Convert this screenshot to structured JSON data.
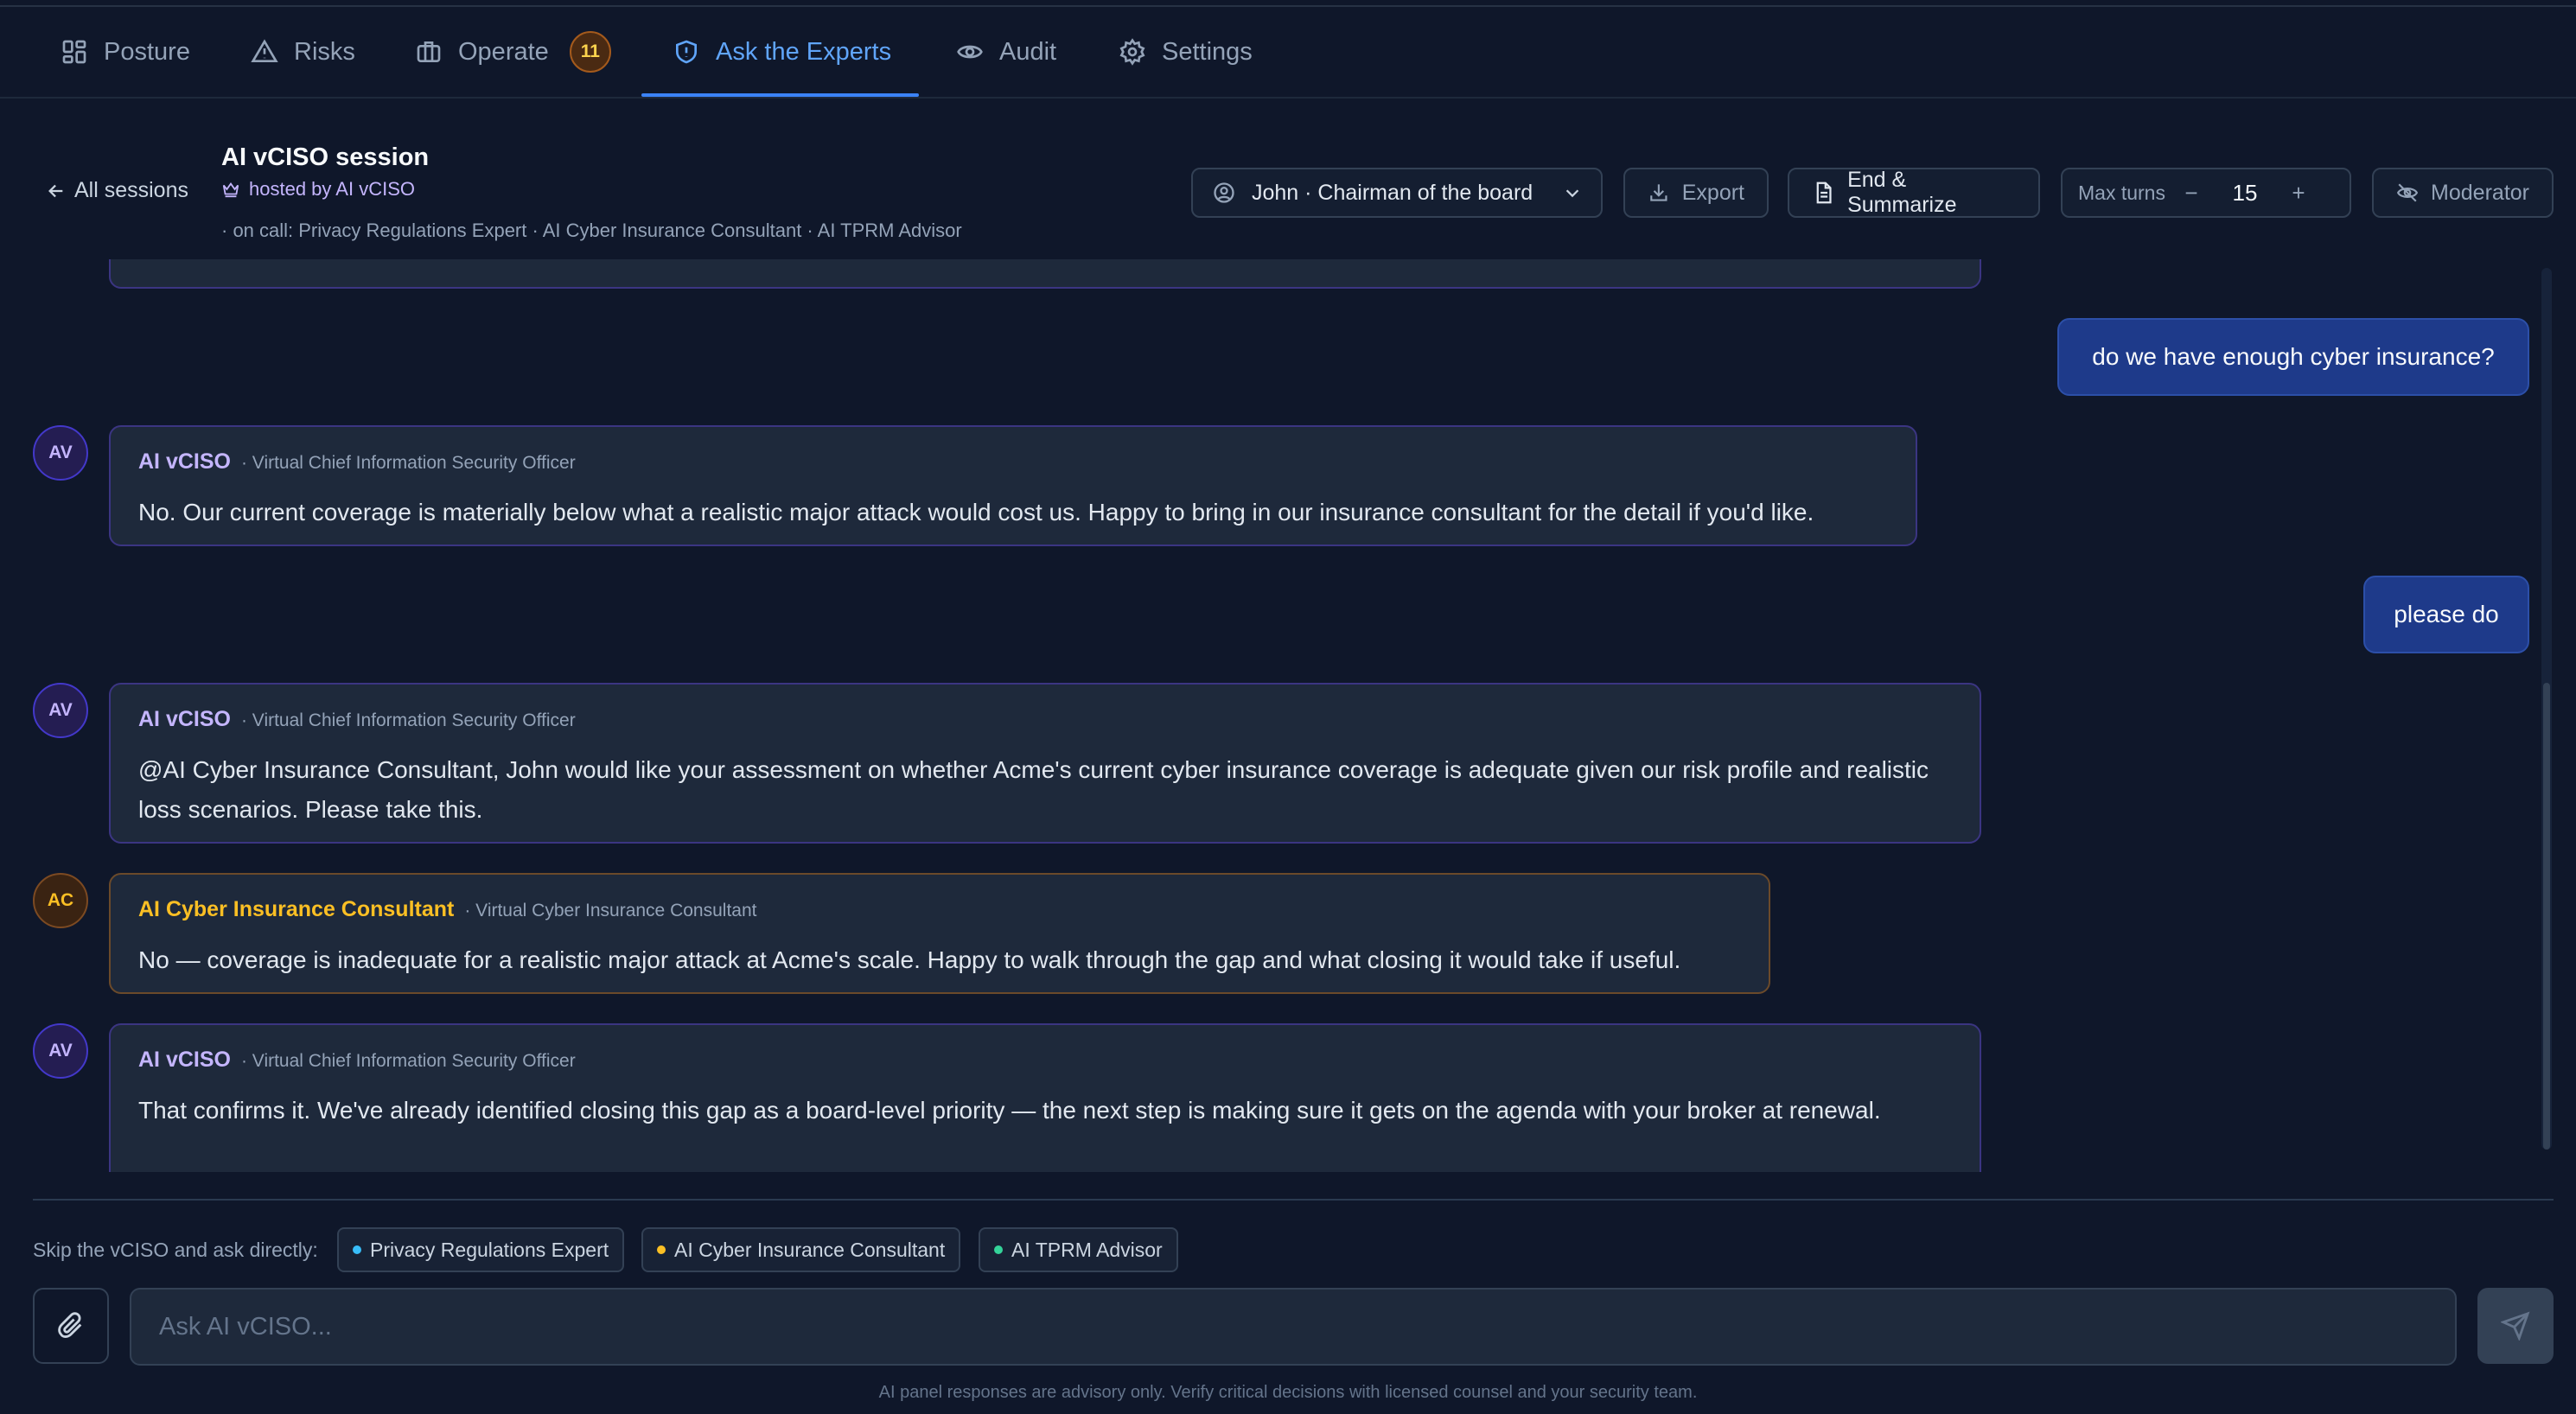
{
  "nav": {
    "tabs": [
      {
        "label": "Posture",
        "icon": "grid-icon"
      },
      {
        "label": "Risks",
        "icon": "warning-triangle-icon"
      },
      {
        "label": "Operate",
        "icon": "briefcase-icon",
        "badge": "11"
      },
      {
        "label": "Ask the Experts",
        "icon": "shield-icon",
        "active": true
      },
      {
        "label": "Audit",
        "icon": "eye-icon"
      },
      {
        "label": "Settings",
        "icon": "gear-icon"
      }
    ]
  },
  "session": {
    "back_label": "All sessions",
    "title": "AI vCISO session",
    "hosted_by": "hosted by AI vCISO",
    "on_call": "· on call: Privacy Regulations Expert · AI Cyber Insurance Consultant · AI TPRM Advisor"
  },
  "controls": {
    "persona": "John · Chairman of the board",
    "export_label": "Export",
    "end_summarize_label": "End & Summarize",
    "max_turns_label": "Max turns",
    "max_turns_minus": "−",
    "max_turns_value": "15",
    "max_turns_plus": "+",
    "moderator_label": "Moderator"
  },
  "messages": [
    {
      "type": "user",
      "text": "do we have enough cyber insurance?"
    },
    {
      "type": "expert",
      "avatar": "AV",
      "name": "AI vCISO",
      "role": "· Virtual Chief Information Security Officer",
      "text": "No. Our current coverage is materially below what a realistic major attack would cost us. Happy to bring in our insurance consultant for the detail if you'd like."
    },
    {
      "type": "user",
      "text": "please do"
    },
    {
      "type": "expert",
      "avatar": "AV",
      "name": "AI vCISO",
      "role": "· Virtual Chief Information Security Officer",
      "text": "@AI Cyber Insurance Consultant, John would like your assessment on whether Acme's current cyber insurance coverage is adequate given our risk profile and realistic loss scenarios. Please take this."
    },
    {
      "type": "expert",
      "avatar": "AC",
      "name": "AI Cyber Insurance Consultant",
      "role": "· Virtual Cyber Insurance Consultant",
      "text": "No — coverage is inadequate for a realistic major attack at Acme's scale. Happy to walk through the gap and what closing it would take if useful."
    },
    {
      "type": "expert",
      "avatar": "AV",
      "name": "AI vCISO",
      "role": "· Virtual Chief Information Security Officer",
      "text": "That confirms it. We've already identified closing this gap as a board-level priority — the next step is making sure it gets on the agenda with your broker at renewal."
    }
  ],
  "composer": {
    "skip_label": "Skip the vCISO and ask directly:",
    "experts": [
      {
        "label": "Privacy Regulations Expert",
        "color": "#38bdf8"
      },
      {
        "label": "AI Cyber Insurance Consultant",
        "color": "#fbbf24"
      },
      {
        "label": "AI TPRM Advisor",
        "color": "#34d399"
      }
    ],
    "placeholder": "Ask AI vCISO...",
    "disclaimer": "AI panel responses are advisory only. Verify critical decisions with licensed counsel and your security team."
  },
  "colors": {
    "background": "#0f172a",
    "accent": "#3b82f6",
    "vciso": "#c4b5fd",
    "insurance": "#fbbf24",
    "user_bubble": "#1e3a8a"
  }
}
